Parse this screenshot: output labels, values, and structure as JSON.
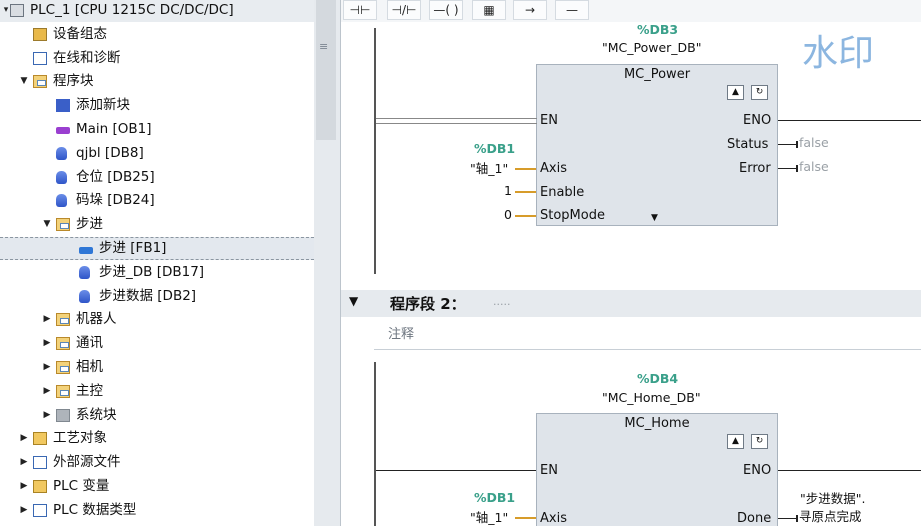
{
  "tree": {
    "items": [
      {
        "label": "PLC_1 [CPU 1215C DC/DC/DC]",
        "icon": "plc-icon",
        "arrow": "▾",
        "indent": 0,
        "top": true
      },
      {
        "label": "设备组态",
        "icon": "device-config-icon",
        "arrow": "",
        "indent": 1
      },
      {
        "label": "在线和诊断",
        "icon": "diagnostics-icon",
        "arrow": "",
        "indent": 1
      },
      {
        "label": "程序块",
        "icon": "folder-icon",
        "arrow": "▼",
        "indent": 1
      },
      {
        "label": "添加新块",
        "icon": "add-block-icon",
        "arrow": "",
        "indent": 2
      },
      {
        "label": "Main [OB1]",
        "icon": "ob-icon",
        "arrow": "",
        "indent": 2
      },
      {
        "label": "qjbl [DB8]",
        "icon": "db-icon",
        "arrow": "",
        "indent": 2
      },
      {
        "label": "仓位 [DB25]",
        "icon": "db-icon",
        "arrow": "",
        "indent": 2
      },
      {
        "label": "码垛 [DB24]",
        "icon": "db-icon",
        "arrow": "",
        "indent": 2
      },
      {
        "label": "步进",
        "icon": "folder-icon",
        "arrow": "▼",
        "indent": 2
      },
      {
        "label": "步进 [FB1]",
        "icon": "fb-icon",
        "arrow": "",
        "indent": 3,
        "selected": true
      },
      {
        "label": "步进_DB [DB17]",
        "icon": "db-icon",
        "arrow": "",
        "indent": 3
      },
      {
        "label": "步进数据 [DB2]",
        "icon": "db-icon",
        "arrow": "",
        "indent": 3
      },
      {
        "label": "机器人",
        "icon": "folder-icon",
        "arrow": "▶",
        "indent": 2
      },
      {
        "label": "通讯",
        "icon": "folder-icon",
        "arrow": "▶",
        "indent": 2
      },
      {
        "label": "相机",
        "icon": "folder-icon",
        "arrow": "▶",
        "indent": 2
      },
      {
        "label": "主控",
        "icon": "folder-icon",
        "arrow": "▶",
        "indent": 2
      },
      {
        "label": "系统块",
        "icon": "system-blocks-icon",
        "arrow": "▶",
        "indent": 2
      },
      {
        "label": "工艺对象",
        "icon": "technology-objects-icon",
        "arrow": "▶",
        "indent": 1
      },
      {
        "label": "外部源文件",
        "icon": "external-source-icon",
        "arrow": "▶",
        "indent": 1
      },
      {
        "label": "PLC 变量",
        "icon": "plc-tags-icon",
        "arrow": "▶",
        "indent": 1
      },
      {
        "label": "PLC 数据类型",
        "icon": "plc-datatypes-icon",
        "arrow": "▶",
        "indent": 1
      }
    ]
  },
  "toolbar": {
    "buttons": [
      "⊣⊢",
      "⊣/⊢",
      "—( )",
      "▦",
      "→",
      "—"
    ]
  },
  "network1": {
    "db_ref": "%DB3",
    "db_name": "\"MC_Power_DB\"",
    "block_title": "MC_Power",
    "en": "EN",
    "eno": "ENO",
    "axis_ref": "%DB1",
    "axis_name": "\"轴_1\"",
    "axis_pin": "Axis",
    "enable_val": "1",
    "enable_pin": "Enable",
    "stopmode_val": "0",
    "stopmode_pin": "StopMode",
    "status_pin": "Status",
    "status_val": "false",
    "error_pin": "Error",
    "error_val": "false"
  },
  "network2": {
    "title": "程序段 2：",
    "dots": ".....",
    "comment": "注释",
    "db_ref": "%DB4",
    "db_name": "\"MC_Home_DB\"",
    "block_title": "MC_Home",
    "en": "EN",
    "eno": "ENO",
    "axis_ref": "%DB1",
    "axis_name": "\"轴_1\"",
    "axis_pin": "Axis",
    "done_pin": "Done",
    "done_var_line1": "\"步进数据\".",
    "done_var_line2": "寻原点完成"
  },
  "watermark": "水印",
  "colors": {
    "rail": "#555555",
    "pin_wire": "#d79c2a",
    "db_ref": "#3aa08a"
  }
}
